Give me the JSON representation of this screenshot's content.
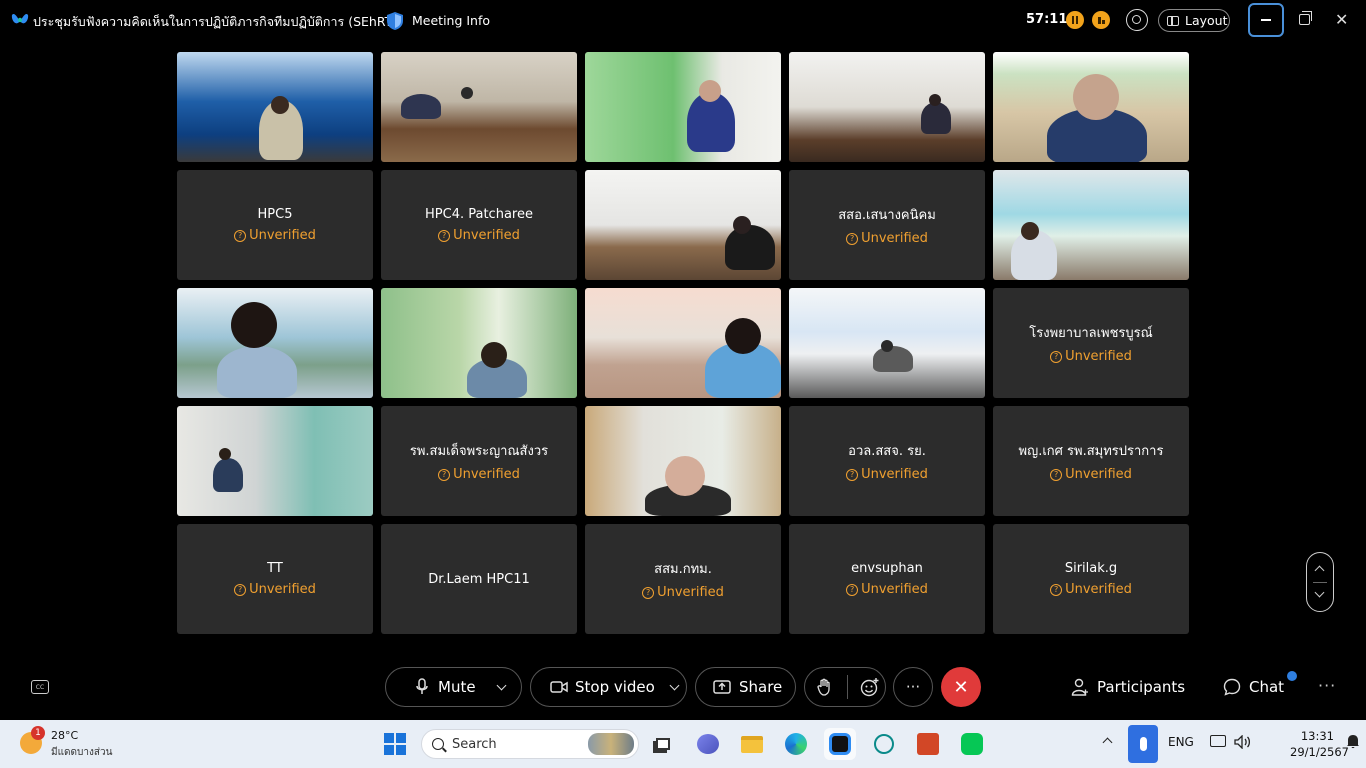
{
  "titlebar": {
    "meeting_title": "ประชุมรับฟังความคิดเห็นในการปฏิบัติภารกิจทีมปฏิบัติการ (SEhRT)",
    "meeting_info_label": "Meeting Info",
    "timer": "57:11",
    "layout_label": "Layout",
    "close_glyph": "✕"
  },
  "grid": {
    "unverified_label": "Unverified",
    "tiles": [
      {
        "type": "video",
        "scene": "blue-stage"
      },
      {
        "type": "video",
        "scene": "conference-room"
      },
      {
        "type": "video",
        "scene": "green-curtain"
      },
      {
        "type": "video",
        "scene": "office-room"
      },
      {
        "type": "video",
        "scene": "beach-banner"
      },
      {
        "type": "name",
        "name": "HPC5",
        "unverified": true
      },
      {
        "type": "name",
        "name": "HPC4. Patcharee",
        "unverified": true
      },
      {
        "type": "video",
        "scene": "meeting-table"
      },
      {
        "type": "name",
        "name": "สสอ.เสนางคนิคม",
        "unverified": true
      },
      {
        "type": "video",
        "scene": "cyan-banner"
      },
      {
        "type": "video",
        "scene": "woman-mural"
      },
      {
        "type": "video",
        "scene": "green-curtain-man"
      },
      {
        "type": "video",
        "scene": "woman-desk"
      },
      {
        "type": "video",
        "scene": "white-stage"
      },
      {
        "type": "name",
        "name": "โรงพยาบาลเพชรบูรณ์",
        "unverified": true
      },
      {
        "type": "video",
        "scene": "long-table"
      },
      {
        "type": "name",
        "name": "รพ.สมเด็จพระญาณสังวร",
        "unverified": true
      },
      {
        "type": "video",
        "scene": "older-woman"
      },
      {
        "type": "name",
        "name": "อวล.สสจ. รย.",
        "unverified": true
      },
      {
        "type": "name",
        "name": "พญ.เกศ รพ.สมุทรปราการ",
        "unverified": true
      },
      {
        "type": "name",
        "name": "TT",
        "unverified": true
      },
      {
        "type": "name",
        "name": "Dr.Laem HPC11",
        "unverified": false
      },
      {
        "type": "name",
        "name": "สสม.กทม.",
        "unverified": true
      },
      {
        "type": "name",
        "name": "envsuphan",
        "unverified": true
      },
      {
        "type": "name",
        "name": "Sirilak.g",
        "unverified": true
      }
    ]
  },
  "controls": {
    "mute_label": "Mute",
    "stop_video_label": "Stop video",
    "share_label": "Share",
    "participants_label": "Participants",
    "chat_label": "Chat",
    "more_glyph": "···",
    "end_glyph": "✕",
    "cc_glyph": "CC"
  },
  "taskbar": {
    "weather_badge": "1",
    "temperature": "28°C",
    "weather_desc": "มีแดดบางส่วน",
    "search_label": "Search",
    "language": "ENG",
    "time": "13:31",
    "date": "29/1/2567"
  },
  "colors": {
    "accent_unverified": "#f0a030",
    "end_call": "#e03a3a",
    "tile_bg": "#2c2c2c"
  }
}
